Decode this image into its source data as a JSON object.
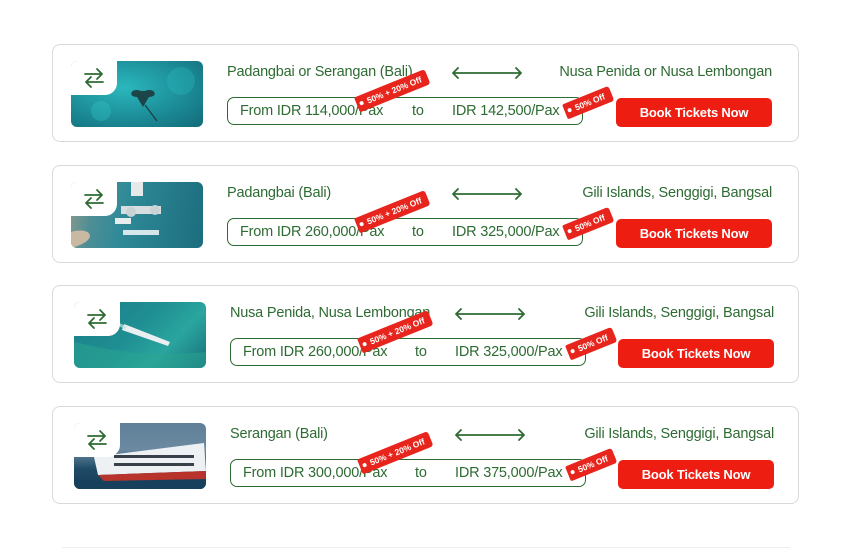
{
  "routes": [
    {
      "from": "Padangbai or Serangan (Bali)",
      "to": "Nusa Penida or Nusa Lembongan",
      "price_from": "From IDR 114,000/Pax",
      "to_word": "to",
      "price_to": "IDR 142,500/Pax",
      "promo_tag": "50% + 20% Off",
      "discount_tag": "50% Off",
      "button": "Book Tickets Now",
      "image": "manta-ray-ocean"
    },
    {
      "from": "Padangbai (Bali)",
      "to": "Gili Islands, Senggigi, Bangsal",
      "price_from": "From IDR 260,000/Pax",
      "to_word": "to",
      "price_to": "IDR 325,000/Pax",
      "promo_tag": "50% + 20% Off",
      "discount_tag": "50% Off",
      "button": "Book Tickets Now",
      "image": "harbor-aerial"
    },
    {
      "from": "Nusa Penida, Nusa Lembongan",
      "to": "Gili Islands, Senggigi, Bangsal",
      "price_from": "From IDR 260,000/Pax",
      "to_word": "to",
      "price_to": "IDR 325,000/Pax",
      "promo_tag": "50% + 20% Off",
      "discount_tag": "50% Off",
      "button": "Book Tickets Now",
      "image": "speedboat-sea"
    },
    {
      "from": "Serangan (Bali)",
      "to": "Gili Islands, Senggigi, Bangsal",
      "price_from": "From IDR 300,000/Pax",
      "to_word": "to",
      "price_to": "IDR 375,000/Pax",
      "promo_tag": "50% + 20% Off",
      "discount_tag": "50% Off",
      "button": "Book Tickets Now",
      "image": "ferry-ship"
    }
  ],
  "colors": {
    "accent_green": "#2e6b33",
    "button_red": "#ee1d12",
    "tag_red": "#e8251c"
  },
  "icons": {
    "swap": "swap-arrows-icon",
    "route": "double-arrow-icon"
  }
}
